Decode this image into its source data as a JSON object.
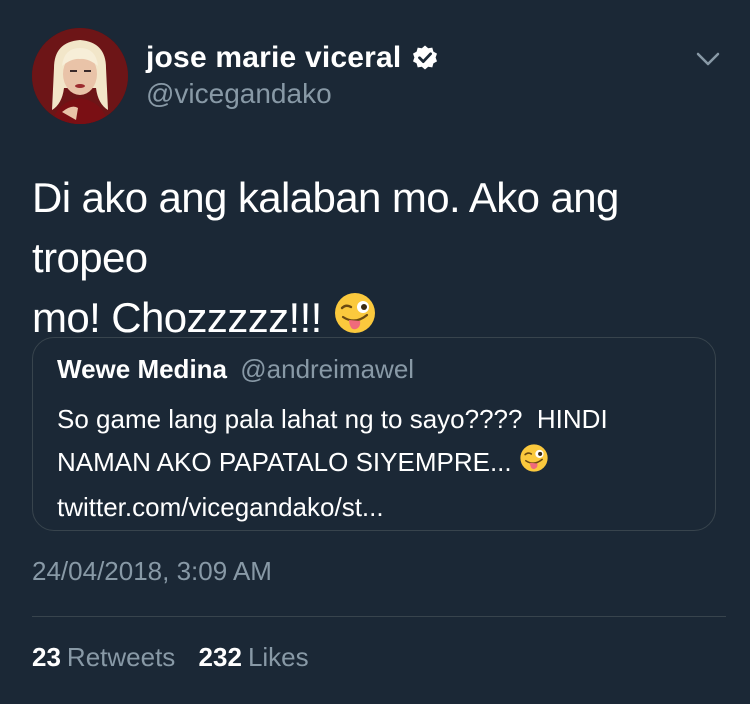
{
  "tweet": {
    "author": {
      "display_name": "jose marie viceral",
      "handle": "@vicegandako",
      "verified": true
    },
    "text_line1": "Di ako ang kalaban mo. Ako ang tropeo",
    "text_line2": "mo! Chozzzzz!!!",
    "timestamp": "24/04/2018, 3:09 AM",
    "retweets_count": "23",
    "retweets_label": "Retweets",
    "likes_count": "232",
    "likes_label": "Likes"
  },
  "quoted_tweet": {
    "display_name": "Wewe Medina",
    "handle": "@andreimawel",
    "line1": "So game lang pala lahat ng to sayo????  HINDI",
    "line2": "NAMAN AKO PAPATALO SIYEMPRE... ",
    "line3": "twitter.com/vicegandako/st..."
  },
  "icons": {
    "verified": "verified-badge-icon",
    "menu": "chevron-down-icon",
    "emoji": "winking-face-with-tongue-emoji"
  },
  "colors": {
    "background": "#1b2836",
    "text_primary": "#ffffff",
    "text_secondary": "#8899a6",
    "border": "#38444d"
  }
}
